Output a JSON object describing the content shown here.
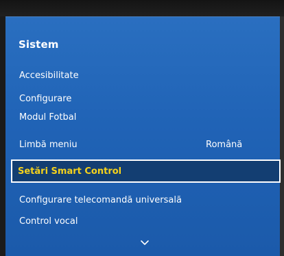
{
  "menu": {
    "title": "Sistem",
    "items": [
      {
        "label": "Accesibilitate"
      },
      {
        "label": "Configurare"
      },
      {
        "label": "Modul Fotbal"
      },
      {
        "label": "Limbă meniu",
        "value": "Română"
      },
      {
        "label": "Setări Smart Control",
        "selected": true
      },
      {
        "label": "Configurare telecomandă universală"
      },
      {
        "label": "Control vocal"
      }
    ],
    "more_indicator_icon": "chevron-down-icon"
  },
  "colors": {
    "panel": "#2063b6",
    "selected_background": "#133e72",
    "selected_text": "#f5d21c",
    "text": "#ffffff"
  }
}
